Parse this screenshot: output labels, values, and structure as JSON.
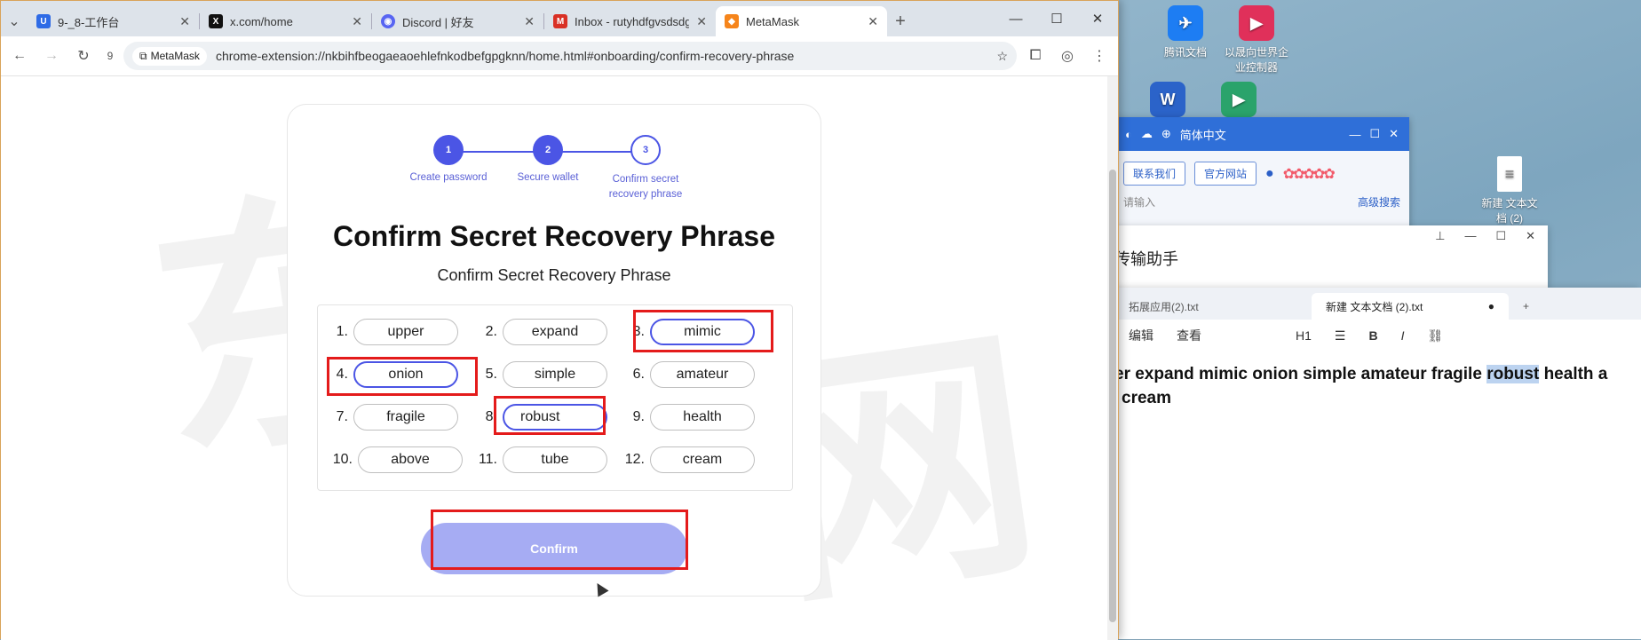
{
  "desktop": {
    "icons": [
      {
        "label": "腾讯文档",
        "color": "#1d7df3",
        "glyph": "✈"
      },
      {
        "label": "以晟向世界企业控制器",
        "color": "#e0305a",
        "glyph": "▶"
      },
      {
        "label": "W",
        "color": "#2b63c9",
        "glyph": "W"
      },
      {
        "label": "",
        "color": "#2aa36b",
        "glyph": "▶"
      },
      {
        "label": "新建 文本文档 (2)",
        "color": "#ffffff",
        "glyph": "≡"
      }
    ]
  },
  "qq": {
    "lang": "简体中文",
    "btn1": "联系我们",
    "btn2": "官方网站",
    "search_placeholder": "请输入",
    "advanced": "高级搜索"
  },
  "helper": {
    "title": "传输助手"
  },
  "notepad": {
    "tab_inactive": "拓展应用(2).txt",
    "tab_active": "新建 文本文档 (2).txt",
    "menu": [
      "编辑",
      "查看",
      "H1",
      "B",
      "I"
    ],
    "line1_pre": "er expand mimic onion simple amateur fragile ",
    "line1_hl": "robust",
    "line1_post": " health a",
    "line2": "cream"
  },
  "browser": {
    "tabs": [
      {
        "title": "9-_8-工作台",
        "icon": "shield-icon",
        "color": "#2e6be6"
      },
      {
        "title": "x.com/home",
        "icon": "x-logo-icon",
        "color": "#111111"
      },
      {
        "title": "Discord | 好友",
        "icon": "discord-icon",
        "color": "#5865f2"
      },
      {
        "title": "Inbox - rutyhdfgvsdsdgd",
        "icon": "gmail-icon",
        "color": "#d93025"
      },
      {
        "title": "MetaMask",
        "icon": "metamask-icon",
        "color": "#f6851b"
      }
    ],
    "ext_count": "9",
    "chip": "MetaMask",
    "url": "chrome-extension://nkbihfbeogaeaoehlefnkodbefgpgknn/home.html#onboarding/confirm-recovery-phrase"
  },
  "metamask": {
    "steps": [
      {
        "num": "1",
        "label": "Create password",
        "done": true
      },
      {
        "num": "2",
        "label": "Secure wallet",
        "done": true
      },
      {
        "num": "3",
        "label": "Confirm secret recovery phrase",
        "done": false
      }
    ],
    "title": "Confirm Secret Recovery Phrase",
    "subtitle": "Confirm Secret Recovery Phrase",
    "words": [
      {
        "n": "1.",
        "w": "upper",
        "state": "static"
      },
      {
        "n": "2.",
        "w": "expand",
        "state": "static"
      },
      {
        "n": "3.",
        "w": "mimic",
        "state": "filled"
      },
      {
        "n": "4.",
        "w": "onion",
        "state": "filled"
      },
      {
        "n": "5.",
        "w": "simple",
        "state": "static"
      },
      {
        "n": "6.",
        "w": "amateur",
        "state": "static"
      },
      {
        "n": "7.",
        "w": "fragile",
        "state": "static"
      },
      {
        "n": "8.",
        "w": "robust",
        "state": "input"
      },
      {
        "n": "9.",
        "w": "health",
        "state": "static"
      },
      {
        "n": "10.",
        "w": "above",
        "state": "static"
      },
      {
        "n": "11.",
        "w": "tube",
        "state": "static"
      },
      {
        "n": "12.",
        "w": "cream",
        "state": "static"
      }
    ],
    "confirm_label": "Confirm"
  },
  "watermark": "东风网络"
}
